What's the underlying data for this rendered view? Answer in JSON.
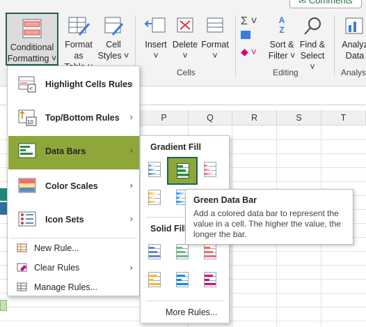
{
  "ribbon": {
    "comments_label": "Comments",
    "conditional_formatting": [
      "Conditional",
      "Formatting ˅"
    ],
    "format_as_table": [
      "Format as",
      "Table ˅"
    ],
    "cell_styles": [
      "Cell",
      "Styles ˅"
    ],
    "insert": [
      "Insert",
      "˅"
    ],
    "delete": [
      "Delete",
      "˅"
    ],
    "format": [
      "Format",
      "˅"
    ],
    "sort_filter": [
      "Sort &",
      "Filter ˅"
    ],
    "find_select": [
      "Find &",
      "Select ˅"
    ],
    "analyze_data": [
      "Analyz",
      "Data"
    ],
    "groups": {
      "cells": "Cells",
      "editing": "Editing",
      "analysis": "Analysis"
    }
  },
  "grid": {
    "columns": [
      "P",
      "Q",
      "R",
      "S",
      "T"
    ]
  },
  "menu": {
    "items": [
      {
        "label": "Highlight Cells Rules",
        "icon": "highlight-cells-icon"
      },
      {
        "label": "Top/Bottom Rules",
        "icon": "top-bottom-icon"
      },
      {
        "label": "Data Bars",
        "icon": "data-bars-icon"
      },
      {
        "label": "Color Scales",
        "icon": "color-scales-icon"
      },
      {
        "label": "Icon Sets",
        "icon": "icon-sets-icon"
      }
    ],
    "simple_items": [
      {
        "label": "New Rule..."
      },
      {
        "label": "Clear Rules"
      },
      {
        "label": "Manage Rules..."
      }
    ]
  },
  "submenu": {
    "gradient_heading": "Gradient Fill",
    "solid_heading": "Solid Fill",
    "more_rules": "More Rules..."
  },
  "tooltip": {
    "title": "Green Data Bar",
    "description": "Add a colored data bar to represent the value in a cell. The higher the value, the longer the bar."
  },
  "colors": {
    "accent_green": "#8fa73a",
    "selection_border": "#1e5e5a",
    "bar_blue": "#5a8ac6",
    "bar_green": "#63be7b",
    "bar_red": "#f8696b",
    "bar_orange": "#ffb628",
    "bar_lightblue": "#008aef",
    "bar_purple": "#d6007b"
  }
}
